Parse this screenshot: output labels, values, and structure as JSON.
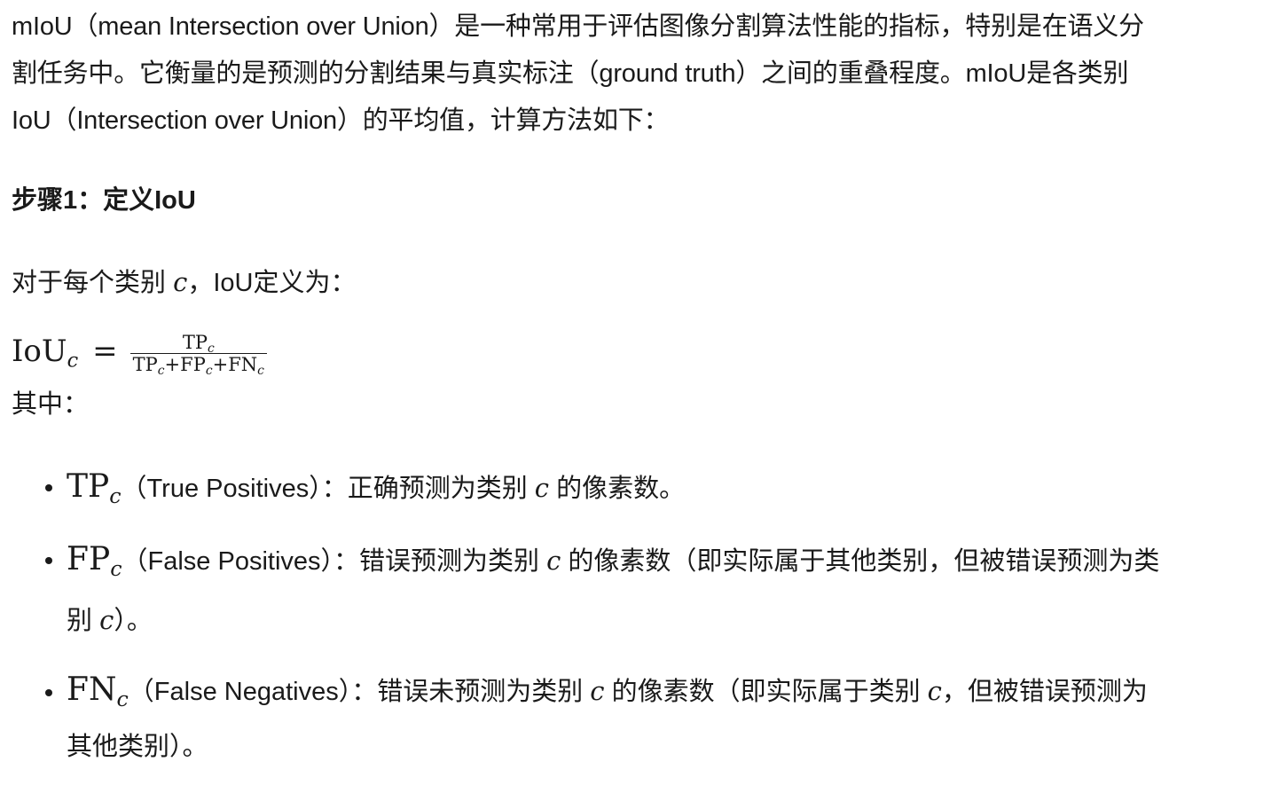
{
  "intro": {
    "line1": "mIoU（mean Intersection over Union）是一种常用于评估图像分割算法性能的指标，特别是在语义分",
    "line2": "割任务中。它衡量的是预测的分割结果与真实标注（ground truth）之间的重叠程度。mIoU是各类别",
    "line3": "IoU（Intersection over Union）的平均值，计算方法如下："
  },
  "step1": {
    "heading": "步骤1：定义IoU",
    "intro_prefix": "对于每个类别 ",
    "intro_var": "c",
    "intro_suffix": "，IoU定义为：",
    "formula": {
      "lhs": "IoU",
      "lhs_sub": "c",
      "equals": "=",
      "numerator": "TP",
      "numerator_sub": "c",
      "den_tp": "TP",
      "den_plus1": "+FP",
      "den_plus2": "+FN",
      "den_sub": "c"
    },
    "where": "其中："
  },
  "definitions": [
    {
      "term": "TP",
      "sub": "c",
      "text_before": "（True Positives）：正确预测为类别 ",
      "var": "c",
      "text_after": " 的像素数。"
    },
    {
      "term": "FP",
      "sub": "c",
      "text_before": "（False Positives）：错误预测为类别 ",
      "var": "c",
      "text_mid": " 的像素数（即实际属于其他类别，但被错误预测为类",
      "line2_before": "别 ",
      "var2": "c",
      "line2_after": "）。"
    },
    {
      "term": "FN",
      "sub": "c",
      "text_before": "（False Negatives）：错误未预测为类别 ",
      "var": "c",
      "text_mid": " 的像素数（即实际属于类别 ",
      "var2": "c",
      "text_after": "，但被错误预测为",
      "line2": "其他类别）。"
    }
  ]
}
